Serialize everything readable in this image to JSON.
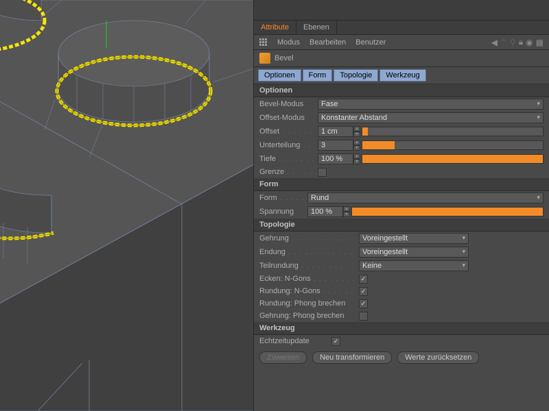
{
  "tabs": {
    "attribute": "Attribute",
    "ebenen": "Ebenen"
  },
  "menu": {
    "modus": "Modus",
    "bearbeiten": "Bearbeiten",
    "benutzer": "Benutzer"
  },
  "tool": {
    "name": "Bevel"
  },
  "subtabs": {
    "optionen": "Optionen",
    "form": "Form",
    "topologie": "Topologie",
    "werkzeug": "Werkzeug"
  },
  "sections": {
    "optionen": "Optionen",
    "form": "Form",
    "topologie": "Topologie",
    "werkzeug": "Werkzeug"
  },
  "labels": {
    "bevel_modus": "Bevel-Modus",
    "offset_modus": "Offset-Modus",
    "offset": "Offset",
    "unterteilung": "Unterteilung",
    "tiefe": "Tiefe",
    "grenze": "Grenze",
    "form": "Form",
    "spannung": "Spannung",
    "gehrung": "Gehrung",
    "endung": "Endung",
    "teilrundung": "Teilrundung",
    "ecken_ngons": "Ecken: N-Gons",
    "rundung_ngons": "Rundung: N-Gons",
    "rundung_phong": "Rundung: Phong brechen",
    "gehrung_phong": "Gehrung: Phong brechen",
    "echtzeit": "Echtzeitupdate"
  },
  "values": {
    "bevel_modus": "Fase",
    "offset_modus": "Konstanter Abstand",
    "offset": "1 cm",
    "unterteilung": "3",
    "tiefe": "100 %",
    "form": "Rund",
    "spannung": "100 %",
    "gehrung": "Voreingestellt",
    "endung": "Voreingestellt",
    "teilrundung": "Keine"
  },
  "sliders": {
    "offset_pct": 3,
    "unterteilung_pct": 18,
    "tiefe_pct": 100,
    "spannung_pct": 100
  },
  "checks": {
    "grenze": false,
    "ecken_ngons": true,
    "rundung_ngons": true,
    "rundung_phong": true,
    "gehrung_phong": false,
    "echtzeit": true
  },
  "buttons": {
    "zuweisen": "Zuweisen",
    "neu_transformieren": "Neu transformieren",
    "werte_zuruecksetzen": "Werte zurücksetzen"
  }
}
